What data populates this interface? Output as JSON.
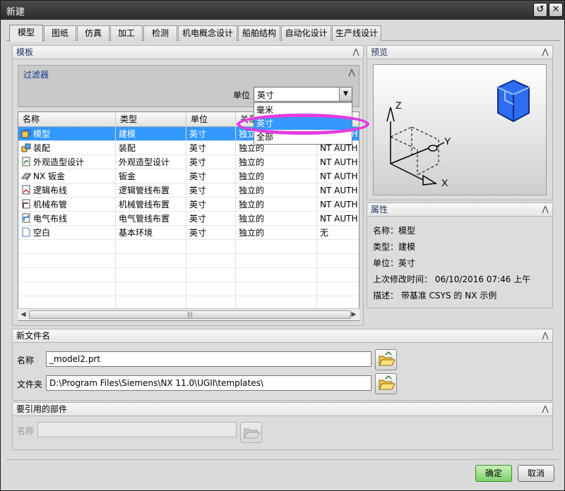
{
  "window": {
    "title": "新建"
  },
  "tabs": [
    "模型",
    "图纸",
    "仿真",
    "加工",
    "检测",
    "机电概念设计",
    "船舶结构",
    "自动化设计",
    "生产线设计"
  ],
  "templates_panel": {
    "title": "模板"
  },
  "filter": {
    "title": "过滤器",
    "unit_label": "单位",
    "unit_value": "英寸",
    "unit_options": [
      "毫米",
      "英寸",
      "全部"
    ]
  },
  "grid": {
    "columns": [
      "名称",
      "类型",
      "单位",
      "关系",
      "所有者"
    ],
    "rows": [
      {
        "name": "模型",
        "type": "建模",
        "unit": "英寸",
        "rel": "独立的",
        "owner": "NT AUTH",
        "icon": "model-icon"
      },
      {
        "name": "装配",
        "type": "装配",
        "unit": "英寸",
        "rel": "独立的",
        "owner": "NT AUTH",
        "icon": "assembly-icon"
      },
      {
        "name": "外观造型设计",
        "type": "外观造型设计",
        "unit": "英寸",
        "rel": "独立的",
        "owner": "NT AUTH",
        "icon": "shape-studio-icon"
      },
      {
        "name": "NX 钣金",
        "type": "钣金",
        "unit": "英寸",
        "rel": "独立的",
        "owner": "NT AUTH",
        "icon": "sheet-metal-icon"
      },
      {
        "name": "逻辑布线",
        "type": "逻辑管线布置",
        "unit": "英寸",
        "rel": "独立的",
        "owner": "NT AUTH",
        "icon": "logical-routing-icon"
      },
      {
        "name": "机械布管",
        "type": "机械管线布置",
        "unit": "英寸",
        "rel": "独立的",
        "owner": "NT AUTH",
        "icon": "mechanical-routing-icon"
      },
      {
        "name": "电气布线",
        "type": "电气管线布置",
        "unit": "英寸",
        "rel": "独立的",
        "owner": "NT AUTH",
        "icon": "electrical-routing-icon"
      },
      {
        "name": "空白",
        "type": "基本环境",
        "unit": "英寸",
        "rel": "独立的",
        "owner": "无",
        "icon": "blank-file-icon"
      }
    ]
  },
  "preview": {
    "title": "预览"
  },
  "properties": {
    "title": "属性",
    "name_label": "名称：",
    "name_value": "模型",
    "type_label": "类型：",
    "type_value": "建模",
    "unit_label": "单位：",
    "unit_value": "英寸",
    "modified_label": "上次修改时间：",
    "modified_value": "06/10/2016 07:46 上午",
    "desc_label": "描述：",
    "desc_value": "带基准 CSYS 的 NX 示例"
  },
  "new_file": {
    "title": "新文件名",
    "name_label": "名称",
    "name_value": "_model2.prt",
    "folder_label": "文件夹",
    "folder_value": "D:\\Program Files\\Siemens\\NX 11.0\\UGII\\templates\\"
  },
  "referenced_parts": {
    "title": "要引用的部件",
    "name_label": "名称",
    "name_value": ""
  },
  "buttons": {
    "ok": "确定",
    "cancel": "取消"
  },
  "colors": {
    "selection": "#3399ff",
    "highlight_ring": "#e23ce0",
    "ok_button": "#7ed06a"
  }
}
